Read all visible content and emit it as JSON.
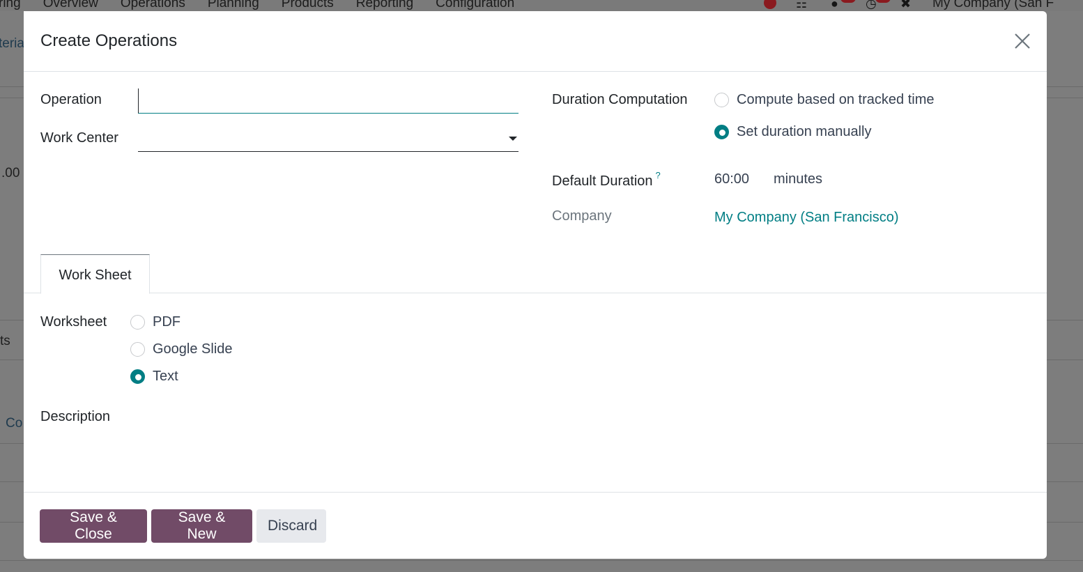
{
  "background": {
    "menu": [
      "ring",
      "Overview",
      "Operations",
      "Planning",
      "Products",
      "Reporting",
      "Configuration"
    ],
    "company": "My Company (San F",
    "side_texts": [
      "teria",
      ".00",
      "ts",
      "Co"
    ]
  },
  "modal": {
    "title": "Create Operations",
    "fields": {
      "operation": {
        "label": "Operation",
        "value": "",
        "placeholder": ""
      },
      "work_center": {
        "label": "Work Center",
        "value": ""
      },
      "duration_computation": {
        "label": "Duration Computation",
        "options": [
          {
            "label": "Compute based on tracked time",
            "checked": false
          },
          {
            "label": "Set duration manually",
            "checked": true
          }
        ]
      },
      "default_duration": {
        "label": "Default Duration",
        "help": "?",
        "value": "60:00",
        "unit": "minutes"
      },
      "company": {
        "label": "Company",
        "value": "My Company (San Francisco)"
      }
    },
    "tabs": [
      {
        "label": "Work Sheet",
        "active": true
      }
    ],
    "worksheet": {
      "label": "Worksheet",
      "options": [
        {
          "label": "PDF",
          "checked": false
        },
        {
          "label": "Google Slide",
          "checked": false
        },
        {
          "label": "Text",
          "checked": true
        }
      ]
    },
    "description": {
      "label": "Description",
      "value": ""
    },
    "footer": {
      "save_close": "Save & Close",
      "save_new": "Save & New",
      "discard": "Discard"
    }
  },
  "colors": {
    "primary": "#714b67",
    "accent": "#017e84",
    "secondary_btn": "#e7e9ed"
  }
}
